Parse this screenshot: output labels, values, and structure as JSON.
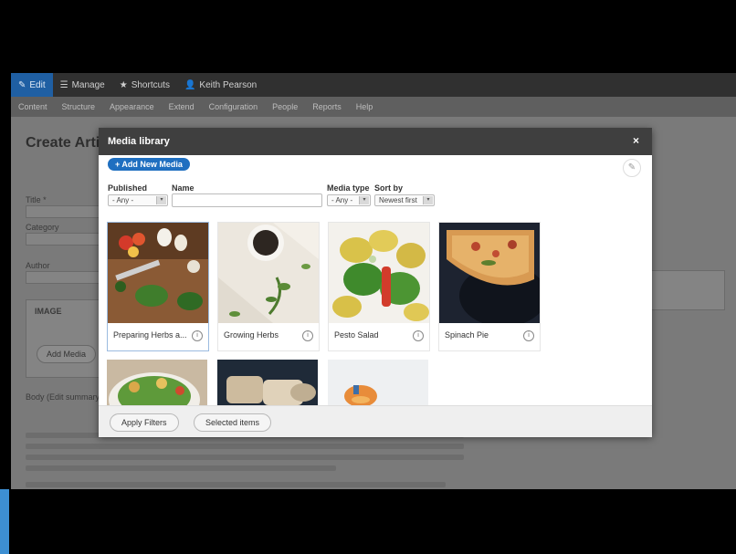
{
  "toolbar": {
    "items": [
      {
        "label": "Edit",
        "icon": "pencil-icon"
      },
      {
        "label": "Manage",
        "icon": "hamburger-icon"
      },
      {
        "label": "Shortcuts",
        "icon": "star-icon"
      },
      {
        "label": "Keith Pearson",
        "icon": "user-icon"
      }
    ],
    "tray": [
      "Content",
      "Structure",
      "Appearance",
      "Extend",
      "Configuration",
      "People",
      "Reports",
      "Help"
    ]
  },
  "page": {
    "title": "Create Artic",
    "labels": [
      "Title *",
      "Category",
      "Author",
      "IMAGE",
      "Add Media",
      "Body (Edit summary)"
    ]
  },
  "modal": {
    "title": "Media library",
    "close": "×",
    "add_button": "+ Add New Media",
    "filters": {
      "published_label": "Published",
      "published_value": "- Any -",
      "name_label": "Name",
      "media_type_label": "Media type",
      "media_type_value": "- Any -",
      "sort_label": "Sort by",
      "sort_value": "Newest first"
    },
    "media": [
      {
        "name": "Preparing Herbs a...",
        "image": "herbs-cutting-board"
      },
      {
        "name": "Growing Herbs",
        "image": "herbs-bowl"
      },
      {
        "name": "Pesto Salad",
        "image": "pasta-salad"
      },
      {
        "name": "Spinach Pie",
        "image": "pie-slice"
      }
    ],
    "footer": {
      "apply": "Apply Filters",
      "selected": "Selected items"
    }
  },
  "colors": {
    "accent": "#1f6fc0",
    "header": "#3f3f3f"
  }
}
